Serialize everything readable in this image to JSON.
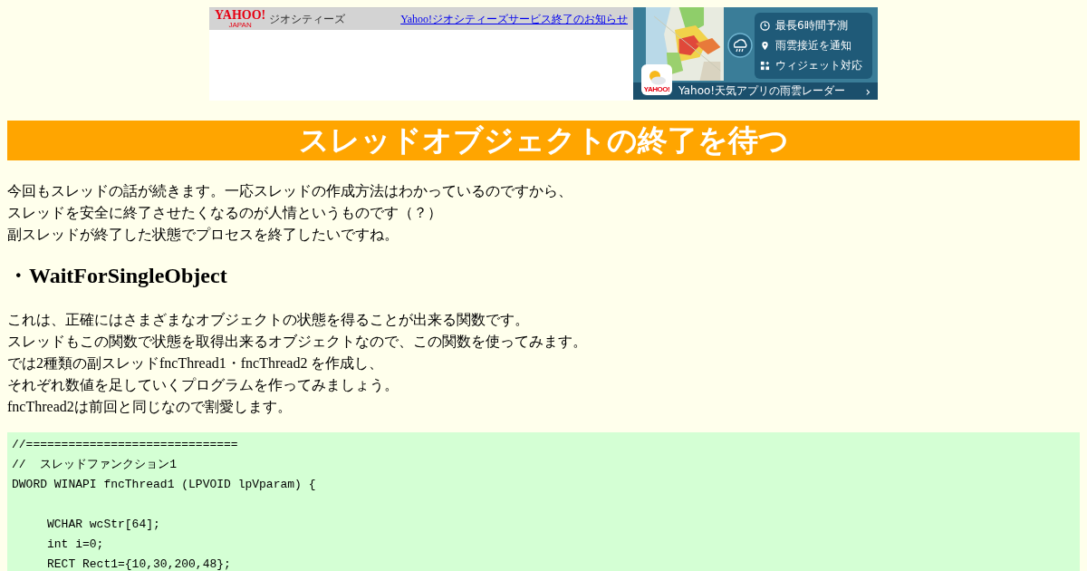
{
  "banner": {
    "logo": "YAHOO!",
    "logo_sub": "JAPAN",
    "service": "ジオシティーズ",
    "notice_link": "Yahoo!ジオシティーズサービス終了のお知らせ"
  },
  "ad": {
    "features": [
      {
        "kind": "clock",
        "text": "最長6時間予測"
      },
      {
        "kind": "pin",
        "text": "雨雲接近を通知"
      },
      {
        "kind": "widget",
        "text": "ウィジェット対応"
      }
    ],
    "app_badge": "YAHOO!",
    "caption": "Yahoo!天気アプリの雨雲レーダー",
    "caption_arrow": "›"
  },
  "title": "スレッドオブジェクトの終了を待つ",
  "intro": [
    "今回もスレッドの話が続きます。一応スレッドの作成方法はわかっているのですから、",
    "スレッドを安全に終了させたくなるのが人情というものです（？）",
    "副スレッドが終了した状態でプロセスを終了したいですね。"
  ],
  "heading": "・WaitForSingleObject",
  "body": [
    "これは、正確にはさまざまなオブジェクトの状態を得ることが出来る関数です。",
    "スレッドもこの関数で状態を取得出来るオブジェクトなので、この関数を使ってみます。",
    "では2種類の副スレッドfncThread1・fncThread2 を作成し、",
    "それぞれ数値を足していくプログラムを作ってみましょう。",
    "fncThread2は前回と同じなので割愛します。"
  ],
  "code_blocks": [
    {
      "lines": [
        "//==============================",
        "//  スレッドファンクション1",
        "DWORD WINAPI fncThread1 (LPVOID lpVparam) {"
      ]
    },
    {
      "lines": [
        "     WCHAR wcStr[64];",
        "     int i=0;",
        "     RECT Rect1={10,30,200,48};"
      ]
    }
  ]
}
